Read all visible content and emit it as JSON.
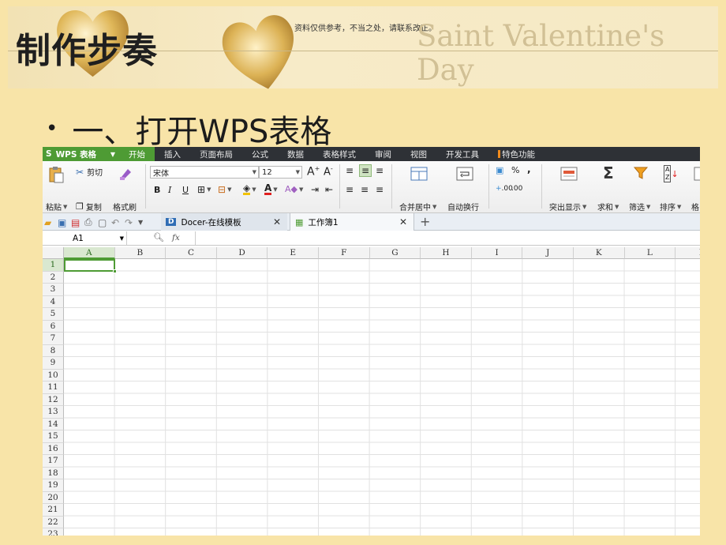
{
  "slide": {
    "title": "制作步奏",
    "notice": "资料仅供参考，不当之处，请联系改正。",
    "decor_text": "Saint Valentine's Day",
    "bullet": "一、打开WPS表格"
  },
  "wps": {
    "app_label": "WPS 表格",
    "menu": [
      "开始",
      "插入",
      "页面布局",
      "公式",
      "数据",
      "表格样式",
      "审阅",
      "视图",
      "开发工具",
      "特色功能"
    ],
    "active_menu": "开始",
    "ribbon": {
      "paste": "粘贴",
      "cut": "剪切",
      "copy": "复制",
      "format_painter": "格式刷",
      "font_name": "宋体",
      "font_size": "12",
      "bold": "B",
      "italic": "I",
      "underline": "U",
      "merge_center": "合并居中",
      "wrap_text": "自动换行",
      "percent": "%",
      "comma": ",",
      "inc_decimal": ".00",
      "dec_decimal": ".00",
      "highlight": "突出显示",
      "sum": "求和",
      "filter": "筛选",
      "sort": "排序",
      "format": "格"
    },
    "tabs": [
      {
        "label": "Docer-在线模板"
      },
      {
        "label": "工作簿1"
      }
    ],
    "namebox": "A1",
    "fx_label": "fx",
    "columns": [
      "A",
      "B",
      "C",
      "D",
      "E",
      "F",
      "G",
      "H",
      "I",
      "J",
      "K",
      "L",
      "I"
    ],
    "rows": [
      "1",
      "2",
      "3",
      "4",
      "5",
      "6",
      "7",
      "8",
      "9",
      "10",
      "11",
      "12",
      "13",
      "14",
      "15",
      "16",
      "17",
      "18",
      "19",
      "20",
      "21",
      "22",
      "23"
    ],
    "colors": {
      "accent": "#4e9b34",
      "menubar": "#2e3136",
      "slide_bg": "#f8e4a8"
    }
  }
}
